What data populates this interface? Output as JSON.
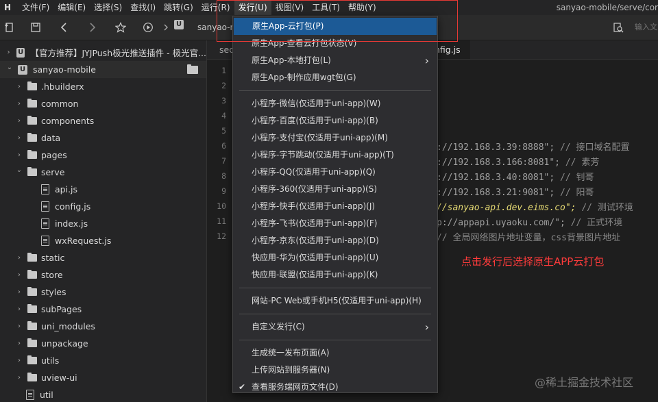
{
  "menubar": {
    "logo": "H",
    "items": [
      "文件(F)",
      "编辑(E)",
      "选择(S)",
      "查找(I)",
      "跳转(G)",
      "运行(R)",
      "发行(U)",
      "视图(V)",
      "工具(T)",
      "帮助(Y)"
    ],
    "active_index": 6
  },
  "title_path": "sanyao-mobile/serve/cor",
  "toolbar": {
    "project_chip": "U",
    "path_text": "sanyao-n",
    "search_placeholder": "输入文"
  },
  "sidebar": {
    "rows": [
      {
        "label": "【官方推荐】JYJPush极光推送插件 - 极光官...",
        "kind": "project",
        "chevron": "›",
        "indent": 0
      },
      {
        "label": "sanyao-mobile",
        "kind": "project",
        "chevron": "⌄",
        "indent": 0,
        "selected": true
      },
      {
        "label": ".hbuilderx",
        "kind": "folder",
        "chevron": "›",
        "indent": 1
      },
      {
        "label": "common",
        "kind": "folder",
        "chevron": "›",
        "indent": 1
      },
      {
        "label": "components",
        "kind": "folder",
        "chevron": "›",
        "indent": 1
      },
      {
        "label": "data",
        "kind": "folder",
        "chevron": "›",
        "indent": 1
      },
      {
        "label": "pages",
        "kind": "folder",
        "chevron": "›",
        "indent": 1
      },
      {
        "label": "serve",
        "kind": "folder",
        "chevron": "⌄",
        "indent": 1
      },
      {
        "label": "api.js",
        "kind": "file",
        "chevron": "",
        "indent": 2
      },
      {
        "label": "config.js",
        "kind": "file",
        "chevron": "",
        "indent": 2
      },
      {
        "label": "index.js",
        "kind": "file",
        "chevron": "",
        "indent": 2
      },
      {
        "label": "wxRequest.js",
        "kind": "file",
        "chevron": "",
        "indent": 2
      },
      {
        "label": "static",
        "kind": "folder",
        "chevron": "›",
        "indent": 1
      },
      {
        "label": "store",
        "kind": "folder",
        "chevron": "›",
        "indent": 1
      },
      {
        "label": "styles",
        "kind": "folder",
        "chevron": "›",
        "indent": 1
      },
      {
        "label": "subPages",
        "kind": "folder",
        "chevron": "›",
        "indent": 1
      },
      {
        "label": "uni_modules",
        "kind": "folder",
        "chevron": "›",
        "indent": 1
      },
      {
        "label": "unpackage",
        "kind": "folder",
        "chevron": "›",
        "indent": 1
      },
      {
        "label": "utils",
        "kind": "folder",
        "chevron": "›",
        "indent": 1
      },
      {
        "label": "uview-ui",
        "kind": "folder",
        "chevron": "›",
        "indent": 1
      },
      {
        "label": "util",
        "kind": "file",
        "chevron": "",
        "indent": 1
      }
    ]
  },
  "editor": {
    "tabs": [
      "sec",
      "nfig.js"
    ],
    "line_numbers": [
      "1",
      "2",
      "3",
      "4",
      "5",
      "6",
      "7",
      "8",
      "9",
      "10",
      "11",
      "12"
    ],
    "code_lines": [
      {
        "line": 6,
        "str": "://192.168.3.39:8888\";",
        "comment": " // 接口域名配置"
      },
      {
        "line": 7,
        "str": "://192.168.3.166:8081\";",
        "comment": " // 素芳"
      },
      {
        "line": 8,
        "str": "://192.168.3.40:8081\";",
        "comment": " // 钊哥"
      },
      {
        "line": 9,
        "str": "://192.168.3.21:9081\";",
        "comment": " // 阳哥"
      },
      {
        "line": 10,
        "str": "//sanyao-api.dev.eims.co\";",
        "comment": " // 测试环境",
        "highlight": true
      },
      {
        "line": 11,
        "str": "p://appapi.uyaoku.com/\";",
        "comment": " // 正式环境"
      },
      {
        "line": 12,
        "str": "",
        "comment": "// 全局网络图片地址变量，css背景图片地址"
      }
    ]
  },
  "annotation": "点击发行后选择原生APP云打包",
  "watermark": "@稀土掘金技术社区",
  "dropdown": {
    "items": [
      {
        "label": "原生App-云打包(P)",
        "hover": true
      },
      {
        "label": "原生App-查看云打包状态(V)"
      },
      {
        "label": "原生App-本地打包(L)",
        "submenu": true
      },
      {
        "label": "原生App-制作应用wgt包(G)"
      },
      {
        "separator": true
      },
      {
        "label": "小程序-微信(仅适用于uni-app)(W)"
      },
      {
        "label": "小程序-百度(仅适用于uni-app)(B)"
      },
      {
        "label": "小程序-支付宝(仅适用于uni-app)(M)"
      },
      {
        "label": "小程序-字节跳动(仅适用于uni-app)(T)"
      },
      {
        "label": "小程序-QQ(仅适用于uni-app)(Q)"
      },
      {
        "label": "小程序-360(仅适用于uni-app)(S)"
      },
      {
        "label": "小程序-快手(仅适用于uni-app)(J)"
      },
      {
        "label": "小程序-飞书(仅适用于uni-app)(F)"
      },
      {
        "label": "小程序-京东(仅适用于uni-app)(D)"
      },
      {
        "label": "快应用-华为(仅适用于uni-app)(U)"
      },
      {
        "label": "快应用-联盟(仅适用于uni-app)(K)"
      },
      {
        "separator": true
      },
      {
        "label": "网站-PC Web或手机H5(仅适用于uni-app)(H)"
      },
      {
        "separator": true
      },
      {
        "label": "自定义发行(C)",
        "submenu": true
      },
      {
        "separator": true
      },
      {
        "label": "生成统一发布页面(A)"
      },
      {
        "label": "上传网站到服务器(N)"
      },
      {
        "label": "查看服务端网页文件(D)",
        "checked": true
      }
    ]
  },
  "colors": {
    "menu_highlight": "#1c5a96",
    "annotation_red": "#ff3b3b",
    "box_red": "#e53935",
    "string_highlight": "#e6db74"
  }
}
